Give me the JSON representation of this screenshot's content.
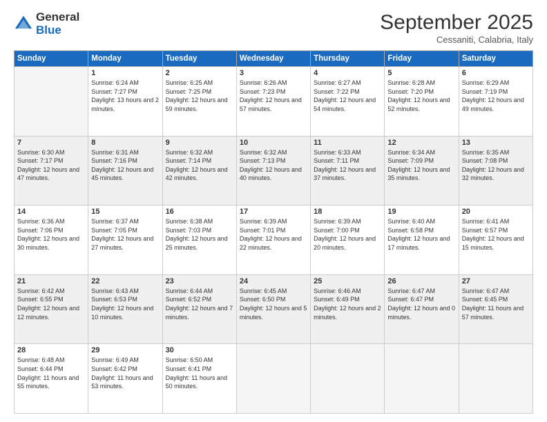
{
  "logo": {
    "general": "General",
    "blue": "Blue"
  },
  "title": "September 2025",
  "location": "Cessaniti, Calabria, Italy",
  "days_of_week": [
    "Sunday",
    "Monday",
    "Tuesday",
    "Wednesday",
    "Thursday",
    "Friday",
    "Saturday"
  ],
  "weeks": [
    [
      {
        "day": "",
        "sunrise": "",
        "sunset": "",
        "daylight": "",
        "empty": true
      },
      {
        "day": "1",
        "sunrise": "Sunrise: 6:24 AM",
        "sunset": "Sunset: 7:27 PM",
        "daylight": "Daylight: 13 hours and 2 minutes."
      },
      {
        "day": "2",
        "sunrise": "Sunrise: 6:25 AM",
        "sunset": "Sunset: 7:25 PM",
        "daylight": "Daylight: 12 hours and 59 minutes."
      },
      {
        "day": "3",
        "sunrise": "Sunrise: 6:26 AM",
        "sunset": "Sunset: 7:23 PM",
        "daylight": "Daylight: 12 hours and 57 minutes."
      },
      {
        "day": "4",
        "sunrise": "Sunrise: 6:27 AM",
        "sunset": "Sunset: 7:22 PM",
        "daylight": "Daylight: 12 hours and 54 minutes."
      },
      {
        "day": "5",
        "sunrise": "Sunrise: 6:28 AM",
        "sunset": "Sunset: 7:20 PM",
        "daylight": "Daylight: 12 hours and 52 minutes."
      },
      {
        "day": "6",
        "sunrise": "Sunrise: 6:29 AM",
        "sunset": "Sunset: 7:19 PM",
        "daylight": "Daylight: 12 hours and 49 minutes."
      }
    ],
    [
      {
        "day": "7",
        "sunrise": "Sunrise: 6:30 AM",
        "sunset": "Sunset: 7:17 PM",
        "daylight": "Daylight: 12 hours and 47 minutes."
      },
      {
        "day": "8",
        "sunrise": "Sunrise: 6:31 AM",
        "sunset": "Sunset: 7:16 PM",
        "daylight": "Daylight: 12 hours and 45 minutes."
      },
      {
        "day": "9",
        "sunrise": "Sunrise: 6:32 AM",
        "sunset": "Sunset: 7:14 PM",
        "daylight": "Daylight: 12 hours and 42 minutes."
      },
      {
        "day": "10",
        "sunrise": "Sunrise: 6:32 AM",
        "sunset": "Sunset: 7:13 PM",
        "daylight": "Daylight: 12 hours and 40 minutes."
      },
      {
        "day": "11",
        "sunrise": "Sunrise: 6:33 AM",
        "sunset": "Sunset: 7:11 PM",
        "daylight": "Daylight: 12 hours and 37 minutes."
      },
      {
        "day": "12",
        "sunrise": "Sunrise: 6:34 AM",
        "sunset": "Sunset: 7:09 PM",
        "daylight": "Daylight: 12 hours and 35 minutes."
      },
      {
        "day": "13",
        "sunrise": "Sunrise: 6:35 AM",
        "sunset": "Sunset: 7:08 PM",
        "daylight": "Daylight: 12 hours and 32 minutes."
      }
    ],
    [
      {
        "day": "14",
        "sunrise": "Sunrise: 6:36 AM",
        "sunset": "Sunset: 7:06 PM",
        "daylight": "Daylight: 12 hours and 30 minutes."
      },
      {
        "day": "15",
        "sunrise": "Sunrise: 6:37 AM",
        "sunset": "Sunset: 7:05 PM",
        "daylight": "Daylight: 12 hours and 27 minutes."
      },
      {
        "day": "16",
        "sunrise": "Sunrise: 6:38 AM",
        "sunset": "Sunset: 7:03 PM",
        "daylight": "Daylight: 12 hours and 25 minutes."
      },
      {
        "day": "17",
        "sunrise": "Sunrise: 6:39 AM",
        "sunset": "Sunset: 7:01 PM",
        "daylight": "Daylight: 12 hours and 22 minutes."
      },
      {
        "day": "18",
        "sunrise": "Sunrise: 6:39 AM",
        "sunset": "Sunset: 7:00 PM",
        "daylight": "Daylight: 12 hours and 20 minutes."
      },
      {
        "day": "19",
        "sunrise": "Sunrise: 6:40 AM",
        "sunset": "Sunset: 6:58 PM",
        "daylight": "Daylight: 12 hours and 17 minutes."
      },
      {
        "day": "20",
        "sunrise": "Sunrise: 6:41 AM",
        "sunset": "Sunset: 6:57 PM",
        "daylight": "Daylight: 12 hours and 15 minutes."
      }
    ],
    [
      {
        "day": "21",
        "sunrise": "Sunrise: 6:42 AM",
        "sunset": "Sunset: 6:55 PM",
        "daylight": "Daylight: 12 hours and 12 minutes."
      },
      {
        "day": "22",
        "sunrise": "Sunrise: 6:43 AM",
        "sunset": "Sunset: 6:53 PM",
        "daylight": "Daylight: 12 hours and 10 minutes."
      },
      {
        "day": "23",
        "sunrise": "Sunrise: 6:44 AM",
        "sunset": "Sunset: 6:52 PM",
        "daylight": "Daylight: 12 hours and 7 minutes."
      },
      {
        "day": "24",
        "sunrise": "Sunrise: 6:45 AM",
        "sunset": "Sunset: 6:50 PM",
        "daylight": "Daylight: 12 hours and 5 minutes."
      },
      {
        "day": "25",
        "sunrise": "Sunrise: 6:46 AM",
        "sunset": "Sunset: 6:49 PM",
        "daylight": "Daylight: 12 hours and 2 minutes."
      },
      {
        "day": "26",
        "sunrise": "Sunrise: 6:47 AM",
        "sunset": "Sunset: 6:47 PM",
        "daylight": "Daylight: 12 hours and 0 minutes."
      },
      {
        "day": "27",
        "sunrise": "Sunrise: 6:47 AM",
        "sunset": "Sunset: 6:45 PM",
        "daylight": "Daylight: 11 hours and 57 minutes."
      }
    ],
    [
      {
        "day": "28",
        "sunrise": "Sunrise: 6:48 AM",
        "sunset": "Sunset: 6:44 PM",
        "daylight": "Daylight: 11 hours and 55 minutes."
      },
      {
        "day": "29",
        "sunrise": "Sunrise: 6:49 AM",
        "sunset": "Sunset: 6:42 PM",
        "daylight": "Daylight: 11 hours and 53 minutes."
      },
      {
        "day": "30",
        "sunrise": "Sunrise: 6:50 AM",
        "sunset": "Sunset: 6:41 PM",
        "daylight": "Daylight: 11 hours and 50 minutes."
      },
      {
        "day": "",
        "sunrise": "",
        "sunset": "",
        "daylight": "",
        "empty": true
      },
      {
        "day": "",
        "sunrise": "",
        "sunset": "",
        "daylight": "",
        "empty": true
      },
      {
        "day": "",
        "sunrise": "",
        "sunset": "",
        "daylight": "",
        "empty": true
      },
      {
        "day": "",
        "sunrise": "",
        "sunset": "",
        "daylight": "",
        "empty": true
      }
    ]
  ]
}
